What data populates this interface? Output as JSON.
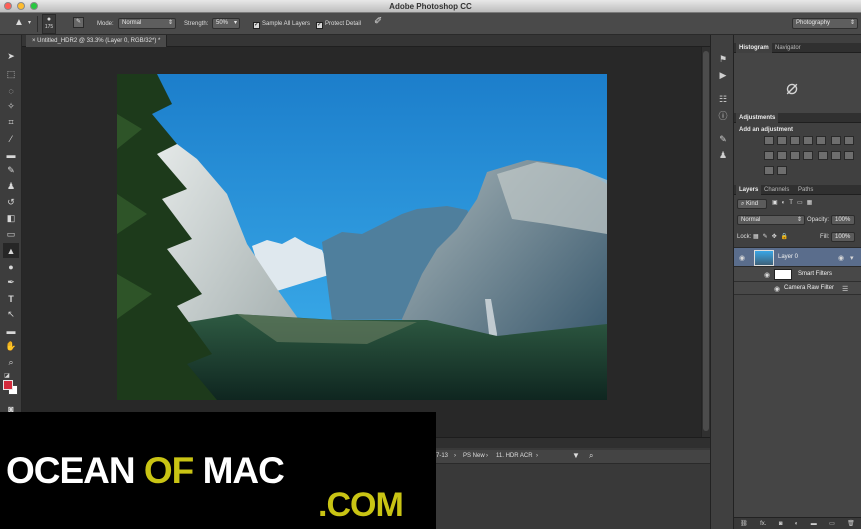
{
  "window": {
    "title": "Adobe Photoshop CC"
  },
  "options_bar": {
    "brush_size": "175",
    "mode_label": "Mode:",
    "mode_value": "Normal",
    "strength_label": "Strength:",
    "strength_value": "50%",
    "sample_all_layers_label": "Sample All Layers",
    "sample_all_layers_checked": true,
    "protect_detail_label": "Protect Detail",
    "protect_detail_checked": true,
    "workspace_value": "Photography"
  },
  "document": {
    "tab_title": "Untitled_HDR2 @ 33.3% (Layer 0, RGB/32*) *"
  },
  "panels": {
    "histogram_tabs": [
      "Histogram",
      "Navigator"
    ],
    "adjustments_tab": "Adjustments",
    "adjustments_subtitle": "Add an adjustment",
    "layers_tabs": [
      "Layers",
      "Channels",
      "Paths"
    ],
    "kind_filter": "Kind",
    "blend_mode": "Normal",
    "opacity_label": "Opacity:",
    "opacity_value": "100%",
    "lock_label": "Lock:",
    "fill_label": "Fill:",
    "fill_value": "100%",
    "layers": [
      {
        "name": "Layer 0"
      },
      {
        "name": "Smart Filters"
      },
      {
        "name": "Camera Raw Filter"
      }
    ],
    "footer_fx": "fx."
  },
  "mini_bridge": {
    "breadcrumbs": [
      "7-13",
      "PS New",
      "11. HDR ACR"
    ]
  },
  "watermark": {
    "ocean": "OCEAN ",
    "of": "OF",
    "mac": " MAC",
    "com": ".COM"
  },
  "colors": {
    "foreground": "#d32b3c",
    "background": "#ffffff",
    "watermark_accent": "#c9c414",
    "layer_selected": "#5a6d8c"
  }
}
